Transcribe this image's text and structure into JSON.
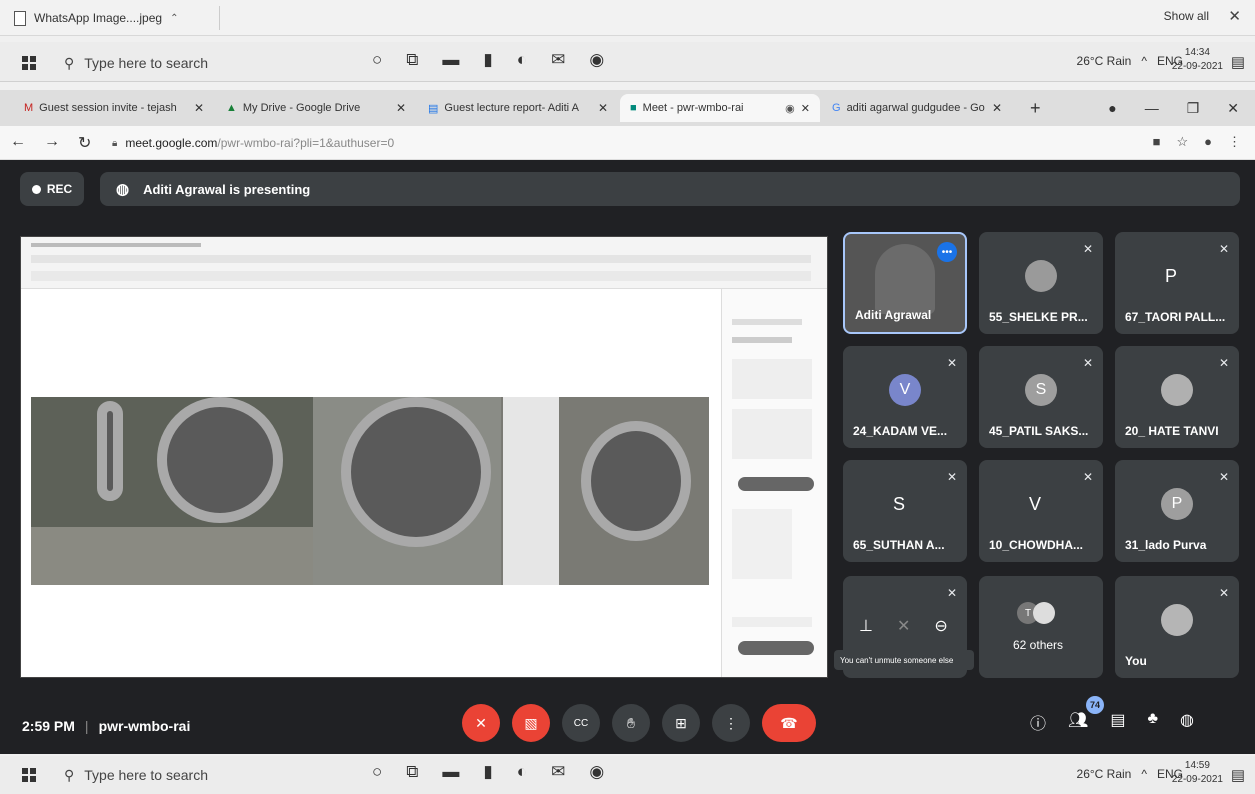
{
  "downloads": {
    "file": "WhatsApp Image....jpeg",
    "show_all": "Show all",
    "close": "✕"
  },
  "taskbar_top": {
    "search_placeholder": "Type here to search",
    "weather": "26°C Rain",
    "lang": "ENG",
    "time": "14:34",
    "date": "22-09-2021"
  },
  "taskbar_bottom": {
    "search_placeholder": "Type here to search",
    "weather": "26°C Rain",
    "lang": "ENG",
    "time": "14:59",
    "date": "22-09-2021"
  },
  "tabs": [
    {
      "label": "Guest session invite - tejash"
    },
    {
      "label": "My Drive - Google Drive"
    },
    {
      "label": "Guest lecture report- Aditi A"
    },
    {
      "label": "Meet - pwr-wmbo-rai"
    },
    {
      "label": "aditi agarwal gudgudee - Go"
    }
  ],
  "address": {
    "host": "meet.google.com",
    "path": "/pwr-wmbo-rai?pli=1&authuser=0"
  },
  "meet": {
    "rec": "REC",
    "presenting": "Aditi Agrawal is presenting",
    "time": "2:59 PM",
    "code": "pwr-wmbo-rai",
    "people_count": "74",
    "tooltip": "You can't unmute someone else"
  },
  "participants": [
    {
      "name": "Aditi Agrawal",
      "kind": "video"
    },
    {
      "name": "55_SHELKE PR...",
      "kind": "photo"
    },
    {
      "name": "67_TAORI PALL...",
      "kind": "letter",
      "letter": "P"
    },
    {
      "name": "24_KADAM VE...",
      "kind": "avatar",
      "letter": "V",
      "color": "#7986cb"
    },
    {
      "name": "45_PATIL SAKS...",
      "kind": "avatar",
      "letter": "S",
      "color": "#9e9e9e"
    },
    {
      "name": "20_ HATE TANVI",
      "kind": "photo"
    },
    {
      "name": "65_SUTHAN A...",
      "kind": "letter",
      "letter": "S"
    },
    {
      "name": "10_CHOWDHA...",
      "kind": "letter",
      "letter": "V"
    },
    {
      "name": "31_lado Purva",
      "kind": "avatar",
      "letter": "P",
      "color": "#9e9e9e"
    },
    {
      "name": "",
      "kind": "controls"
    },
    {
      "name": "62 others",
      "kind": "others"
    },
    {
      "name": "You",
      "kind": "photo"
    }
  ],
  "colors": {
    "meet_bg": "#202124",
    "tile_bg": "#3c4043",
    "end_red": "#ea4335",
    "accent_blue": "#8ab4f8"
  }
}
